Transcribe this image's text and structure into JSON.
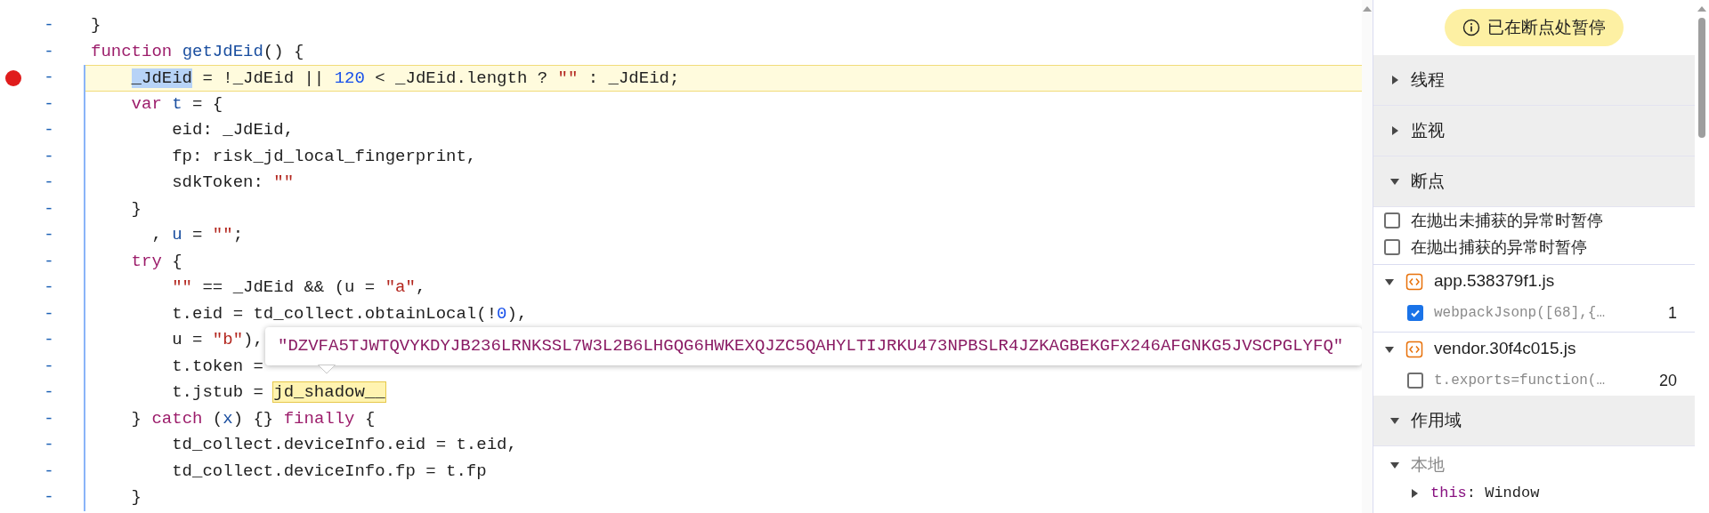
{
  "code": {
    "lines": [
      {
        "marker": "-",
        "breakpoint": false,
        "paused": false,
        "tokens": [
          {
            "text": "}",
            "kind": "plain"
          }
        ]
      },
      {
        "marker": "-",
        "breakpoint": false,
        "paused": false,
        "tokens": [
          {
            "text": "function ",
            "kind": "keyword"
          },
          {
            "text": "getJdEid",
            "kind": "def"
          },
          {
            "text": "() {",
            "kind": "plain"
          }
        ]
      },
      {
        "marker": "-",
        "breakpoint": true,
        "paused": true,
        "tokens": [
          {
            "text": "    _JdEid",
            "kind": "selected"
          },
          {
            "text": " = !_JdEid || ",
            "kind": "plain"
          },
          {
            "text": "120",
            "kind": "number"
          },
          {
            "text": " < _JdEid.length ? ",
            "kind": "plain"
          },
          {
            "text": "\"\"",
            "kind": "string"
          },
          {
            "text": " : _JdEid;",
            "kind": "plain"
          }
        ]
      },
      {
        "marker": "-",
        "breakpoint": false,
        "paused": false,
        "tokens": [
          {
            "text": "    var ",
            "kind": "keyword"
          },
          {
            "text": "t",
            "kind": "var"
          },
          {
            "text": " = {",
            "kind": "plain"
          }
        ]
      },
      {
        "marker": "-",
        "breakpoint": false,
        "paused": false,
        "tokens": [
          {
            "text": "        eid: _JdEid,",
            "kind": "plain"
          }
        ]
      },
      {
        "marker": "-",
        "breakpoint": false,
        "paused": false,
        "tokens": [
          {
            "text": "        fp: risk_jd_local_fingerprint,",
            "kind": "plain"
          }
        ]
      },
      {
        "marker": "-",
        "breakpoint": false,
        "paused": false,
        "tokens": [
          {
            "text": "        sdkToken: ",
            "kind": "plain"
          },
          {
            "text": "\"\"",
            "kind": "string"
          }
        ]
      },
      {
        "marker": "-",
        "breakpoint": false,
        "paused": false,
        "tokens": [
          {
            "text": "    }",
            "kind": "plain"
          }
        ]
      },
      {
        "marker": "-",
        "breakpoint": false,
        "paused": false,
        "tokens": [
          {
            "text": "      , ",
            "kind": "plain"
          },
          {
            "text": "u",
            "kind": "var"
          },
          {
            "text": " = ",
            "kind": "plain"
          },
          {
            "text": "\"\"",
            "kind": "string"
          },
          {
            "text": ";",
            "kind": "plain"
          }
        ]
      },
      {
        "marker": "-",
        "breakpoint": false,
        "paused": false,
        "tokens": [
          {
            "text": "    try",
            "kind": "keyword"
          },
          {
            "text": " {",
            "kind": "plain"
          }
        ]
      },
      {
        "marker": "-",
        "breakpoint": false,
        "paused": false,
        "tokens": [
          {
            "text": "        \"\"",
            "kind": "string"
          },
          {
            "text": " == _JdEid && (u = ",
            "kind": "plain"
          },
          {
            "text": "\"a\"",
            "kind": "string"
          },
          {
            "text": ",",
            "kind": "plain"
          }
        ]
      },
      {
        "marker": "-",
        "breakpoint": false,
        "paused": false,
        "tokens": [
          {
            "text": "        t.eid = td_collect.obtainLocal(!",
            "kind": "plain"
          },
          {
            "text": "0",
            "kind": "number"
          },
          {
            "text": "),",
            "kind": "plain"
          }
        ]
      },
      {
        "marker": "-",
        "breakpoint": false,
        "paused": false,
        "tokens": [
          {
            "text": "        u = ",
            "kind": "plain"
          },
          {
            "text": "\"b\"",
            "kind": "string"
          },
          {
            "text": "),",
            "kind": "plain"
          }
        ]
      },
      {
        "marker": "-",
        "breakpoint": false,
        "paused": false,
        "tokens": [
          {
            "text": "        t.token =",
            "kind": "plain"
          }
        ]
      },
      {
        "marker": "-",
        "breakpoint": false,
        "paused": false,
        "tokens": [
          {
            "text": "        t.jstub = ",
            "kind": "plain"
          },
          {
            "text": "jd_shadow__",
            "kind": "hover"
          }
        ]
      },
      {
        "marker": "-",
        "breakpoint": false,
        "paused": false,
        "tokens": [
          {
            "text": "    } ",
            "kind": "plain"
          },
          {
            "text": "catch",
            "kind": "keyword"
          },
          {
            "text": " (",
            "kind": "plain"
          },
          {
            "text": "x",
            "kind": "var"
          },
          {
            "text": ") {} ",
            "kind": "plain"
          },
          {
            "text": "finally",
            "kind": "keyword"
          },
          {
            "text": " {",
            "kind": "plain"
          }
        ]
      },
      {
        "marker": "-",
        "breakpoint": false,
        "paused": false,
        "tokens": [
          {
            "text": "        td_collect.deviceInfo.eid = t.eid,",
            "kind": "plain"
          }
        ]
      },
      {
        "marker": "-",
        "breakpoint": false,
        "paused": false,
        "tokens": [
          {
            "text": "        td_collect.deviceInfo.fp = t.fp",
            "kind": "plain"
          }
        ]
      },
      {
        "marker": "-",
        "breakpoint": false,
        "paused": false,
        "tokens": [
          {
            "text": "    }",
            "kind": "plain"
          }
        ]
      }
    ]
  },
  "tooltip": {
    "text": "\"DZVFA5TJWTQVYKDYJB236LRNKSSL7W3L2B6LHGQG6HWKEXQJZC5QAHYLTIJRKU473NPBSLR4JZKAGBEKGFX246AFGNKG5JVSCPGLYFQ\""
  },
  "debugger": {
    "status": "已在断点处暂停",
    "items": [
      {
        "kind": "section",
        "label": "线程",
        "expanded": false
      },
      {
        "kind": "section",
        "label": "监视",
        "expanded": false
      },
      {
        "kind": "section",
        "label": "断点",
        "expanded": true
      },
      {
        "kind": "option",
        "label": "在抛出未捕获的异常时暂停",
        "checked": false
      },
      {
        "kind": "option",
        "label": "在抛出捕获的异常时暂停",
        "checked": false
      },
      {
        "kind": "file",
        "label": "app.538379f1.js",
        "expanded": true
      },
      {
        "kind": "breakpoint",
        "label": "webpackJsonp([68],{…",
        "line": "1",
        "checked": true
      },
      {
        "kind": "file",
        "label": "vendor.30f4c015.js",
        "expanded": true
      },
      {
        "kind": "breakpoint",
        "label": "t.exports=function(…",
        "line": "20",
        "checked": false
      },
      {
        "kind": "section",
        "label": "作用域",
        "expanded": true
      },
      {
        "kind": "scope",
        "label": "本地",
        "expanded": true
      },
      {
        "kind": "property",
        "label": "this",
        "separator": ":",
        "value": "Window",
        "expanded": false
      }
    ]
  }
}
